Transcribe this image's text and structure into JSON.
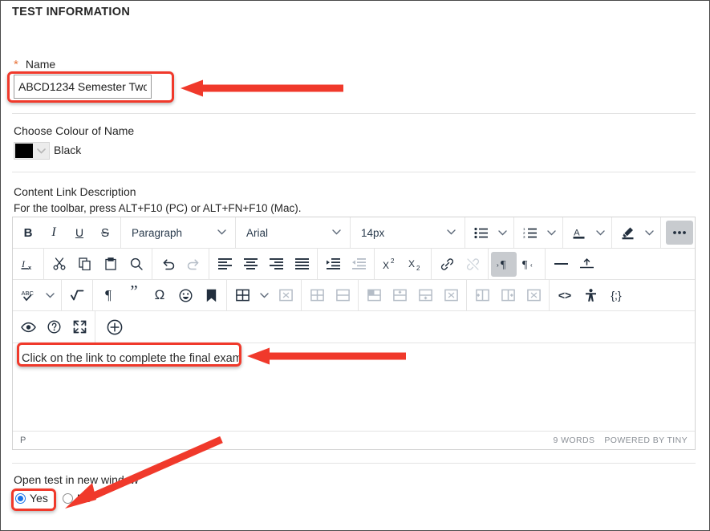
{
  "section": {
    "title": "TEST INFORMATION"
  },
  "name_field": {
    "label": "Name",
    "required_marker": "*",
    "value": "ABCD1234 Semester Two",
    "placeholder": ""
  },
  "colour_field": {
    "label": "Choose Colour of Name",
    "selected_colour_name": "Black",
    "selected_colour_hex": "#000000"
  },
  "content_link": {
    "label": "Content Link Description",
    "hint": "For the toolbar, press ALT+F10 (PC) or ALT+FN+F10 (Mac)."
  },
  "editor": {
    "toolbar_rows": [
      {
        "groups": [
          {
            "items": [
              {
                "name": "bold-icon",
                "glyph": "B",
                "style": "bold"
              },
              {
                "name": "italic-icon",
                "glyph": "I",
                "style": "italic"
              },
              {
                "name": "underline-icon",
                "glyph": "U",
                "style": "underline"
              },
              {
                "name": "strikethrough-icon",
                "glyph": "S",
                "style": "strike"
              }
            ]
          },
          {
            "select": {
              "name": "block-format-select",
              "value": "Paragraph"
            }
          },
          {
            "select": {
              "name": "font-family-select",
              "value": "Arial"
            }
          },
          {
            "select": {
              "name": "font-size-select",
              "value": "14px"
            }
          },
          {
            "items": [
              {
                "name": "bullet-list-icon",
                "glyph": "bullets",
                "caret": true
              }
            ]
          },
          {
            "items": [
              {
                "name": "numbered-list-icon",
                "glyph": "numbers",
                "caret": true
              }
            ]
          },
          {
            "items": [
              {
                "name": "text-color-icon",
                "glyph": "A",
                "caret": true
              }
            ]
          },
          {
            "items": [
              {
                "name": "highlight-color-icon",
                "glyph": "pen",
                "caret": true
              }
            ]
          },
          {
            "items": [
              {
                "name": "more-options-icon",
                "glyph": "•••",
                "active": true
              }
            ]
          }
        ]
      },
      {
        "groups": [
          {
            "items": [
              {
                "name": "clear-formatting-icon",
                "glyph": "Ix"
              }
            ]
          },
          {
            "items": [
              {
                "name": "cut-icon",
                "glyph": "scissors"
              },
              {
                "name": "copy-icon",
                "glyph": "copy"
              },
              {
                "name": "paste-icon",
                "glyph": "clipboard"
              },
              {
                "name": "find-replace-icon",
                "glyph": "magnifier"
              }
            ]
          },
          {
            "items": [
              {
                "name": "undo-icon",
                "glyph": "undo"
              },
              {
                "name": "redo-icon",
                "glyph": "redo",
                "disabled": true
              }
            ]
          },
          {
            "items": [
              {
                "name": "align-left-icon",
                "glyph": "align-left"
              },
              {
                "name": "align-center-icon",
                "glyph": "align-center"
              },
              {
                "name": "align-right-icon",
                "glyph": "align-right"
              },
              {
                "name": "align-justify-icon",
                "glyph": "align-justify"
              }
            ]
          },
          {
            "items": [
              {
                "name": "indent-increase-icon",
                "glyph": "indent"
              },
              {
                "name": "indent-decrease-icon",
                "glyph": "outdent",
                "disabled": true
              }
            ]
          },
          {
            "items": [
              {
                "name": "superscript-icon",
                "glyph": "x2up"
              },
              {
                "name": "subscript-icon",
                "glyph": "x2down"
              }
            ]
          },
          {
            "items": [
              {
                "name": "insert-link-icon",
                "glyph": "link"
              },
              {
                "name": "remove-link-icon",
                "glyph": "unlink",
                "disabled": true
              }
            ]
          },
          {
            "items": [
              {
                "name": "ltr-direction-icon",
                "glyph": "ltr",
                "active": true
              },
              {
                "name": "rtl-direction-icon",
                "glyph": "rtl"
              }
            ]
          },
          {
            "items": [
              {
                "name": "horizontal-rule-icon",
                "glyph": "hr"
              },
              {
                "name": "page-break-icon",
                "glyph": "pagebreak"
              }
            ]
          }
        ]
      },
      {
        "groups": [
          {
            "items": [
              {
                "name": "spellcheck-icon",
                "glyph": "ABC",
                "caret": true
              }
            ]
          },
          {
            "items": [
              {
                "name": "math-equation-icon",
                "glyph": "sqrt"
              }
            ]
          },
          {
            "items": [
              {
                "name": "show-blocks-icon",
                "glyph": "pilcrow"
              },
              {
                "name": "blockquote-icon",
                "glyph": "quote"
              },
              {
                "name": "special-character-icon",
                "glyph": "omega"
              },
              {
                "name": "emoticons-icon",
                "glyph": "smiley"
              },
              {
                "name": "anchor-icon",
                "glyph": "bookmark"
              }
            ]
          },
          {
            "items": [
              {
                "name": "insert-table-icon",
                "glyph": "table",
                "caret": true
              },
              {
                "name": "delete-table-icon",
                "glyph": "table-delete",
                "disabled": true
              }
            ]
          },
          {
            "items": [
              {
                "name": "table-cell-properties-icon",
                "glyph": "cell-props",
                "disabled": true
              },
              {
                "name": "merge-cells-icon",
                "glyph": "cell-merge",
                "disabled": true
              }
            ]
          },
          {
            "items": [
              {
                "name": "table-row-properties-icon",
                "glyph": "row-props",
                "disabled": true
              },
              {
                "name": "insert-row-above-icon",
                "glyph": "row-above",
                "disabled": true
              },
              {
                "name": "insert-row-below-icon",
                "glyph": "row-below",
                "disabled": true
              },
              {
                "name": "delete-row-icon",
                "glyph": "row-delete",
                "disabled": true
              }
            ]
          },
          {
            "items": [
              {
                "name": "insert-column-before-icon",
                "glyph": "col-before",
                "disabled": true
              },
              {
                "name": "insert-column-after-icon",
                "glyph": "col-after",
                "disabled": true
              },
              {
                "name": "delete-column-icon",
                "glyph": "col-delete",
                "disabled": true
              }
            ]
          },
          {
            "items": [
              {
                "name": "source-code-icon",
                "glyph": "<>"
              },
              {
                "name": "accessibility-check-icon",
                "glyph": "a11y"
              },
              {
                "name": "code-sample-icon",
                "glyph": "{;}"
              }
            ]
          }
        ]
      },
      {
        "groups": [
          {
            "items": [
              {
                "name": "preview-icon",
                "glyph": "eye"
              },
              {
                "name": "help-icon",
                "glyph": "question"
              },
              {
                "name": "fullscreen-icon",
                "glyph": "expand"
              }
            ]
          },
          {
            "items": [
              {
                "name": "insert-content-icon",
                "glyph": "plus-circle"
              }
            ]
          }
        ]
      }
    ],
    "body_text": "Click on the link to complete the final exam",
    "status": {
      "path": "P",
      "word_count": "9 WORDS",
      "branding": "POWERED BY TINY"
    }
  },
  "open_in_new_window": {
    "label": "Open test in new window",
    "options": [
      {
        "label": "Yes",
        "selected": true
      },
      {
        "label": "No",
        "selected": false
      }
    ]
  },
  "annotations": {
    "highlight_color": "#f0392b",
    "arrow_color": "#f0392b",
    "count": 3
  }
}
